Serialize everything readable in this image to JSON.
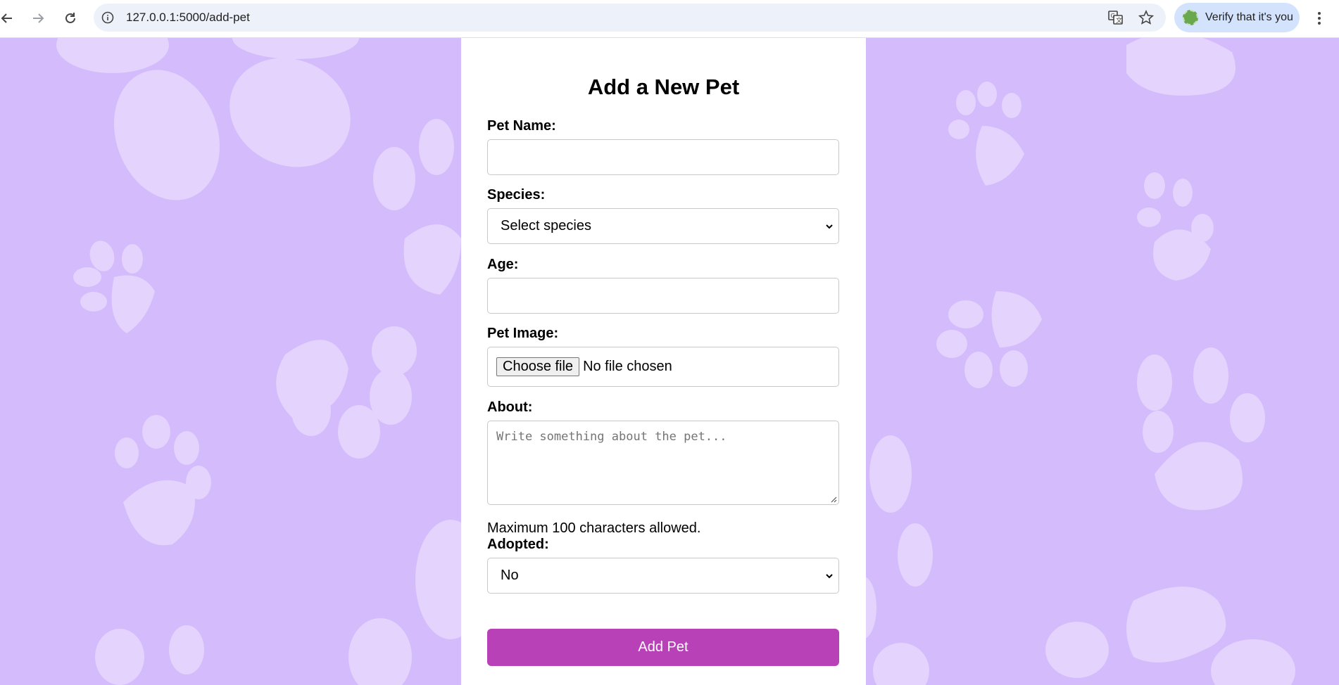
{
  "browser": {
    "url": "127.0.0.1:5000/add-pet",
    "profile_label": "Verify that it's you",
    "icons": {
      "back": "back-arrow-icon",
      "forward": "forward-arrow-icon",
      "reload": "reload-icon",
      "site_info": "info-icon",
      "translate": "translate-icon",
      "bookmark": "star-icon",
      "menu": "kebab-menu-icon"
    }
  },
  "form": {
    "title": "Add a New Pet",
    "pet_name_label": "Pet Name:",
    "pet_name_value": "",
    "species_label": "Species:",
    "species_selected": "Select species",
    "age_label": "Age:",
    "age_value": "",
    "image_label": "Pet Image:",
    "file_button": "Choose file",
    "file_status": "No file chosen",
    "about_label": "About:",
    "about_placeholder": "Write something about the pet...",
    "about_hint": "Maximum 100 characters allowed.",
    "adopted_label": "Adopted:",
    "adopted_selected": "No",
    "submit_label": "Add Pet"
  },
  "colors": {
    "background": "#d4bbfb",
    "paw": "#e3d3fd",
    "submit": "#b841b8"
  }
}
